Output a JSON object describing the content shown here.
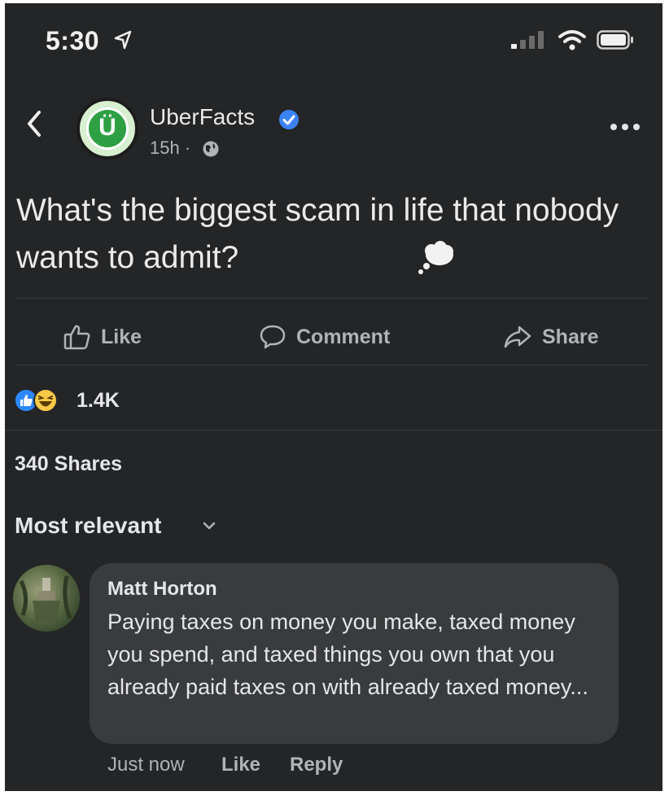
{
  "status_bar": {
    "time": "5:30"
  },
  "post": {
    "page_name": "UberFacts",
    "avatar_letter": "Ü",
    "time_ago": "15h ·",
    "text": "What's the biggest scam in life that nobody wants to admit?",
    "actions": {
      "like": "Like",
      "comment": "Comment",
      "share": "Share"
    },
    "reaction_count": "1.4K",
    "shares": "340 Shares"
  },
  "comments": {
    "sort_label": "Most relevant",
    "items": [
      {
        "author": "Matt Horton",
        "text": "Paying taxes on money you make, taxed money you spend, and taxed things you own that you already paid taxes on with already taxed money...",
        "time": "Just now",
        "like": "Like",
        "reply": "Reply"
      }
    ]
  },
  "colors": {
    "background": "#242526",
    "bubble": "#3a3b3c",
    "verified_blue": "#3b82f6",
    "brand_green": "#2ea043"
  }
}
